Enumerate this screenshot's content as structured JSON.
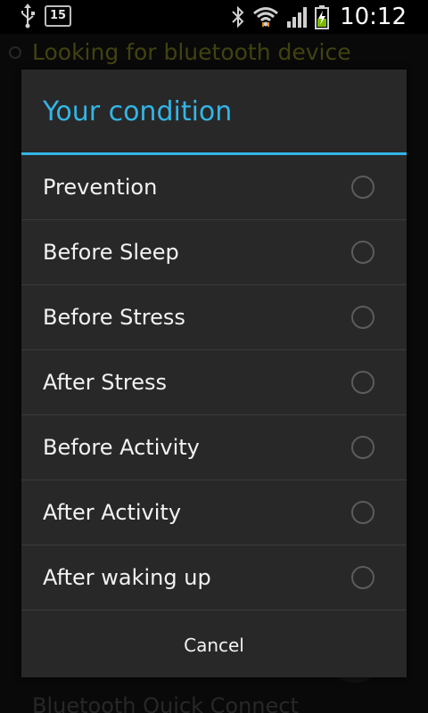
{
  "status_bar": {
    "notification_count": "15",
    "time": "10:12",
    "icons": [
      "usb-icon",
      "bluetooth-icon",
      "wifi-icon",
      "signal-icon",
      "battery-charging-icon"
    ]
  },
  "background": {
    "connection_status": "Looking for bluetooth device",
    "footer_label": "Bluetooth Quick Connect"
  },
  "dialog": {
    "title": "Your condition",
    "options": [
      {
        "label": "Prevention",
        "selected": false
      },
      {
        "label": "Before Sleep",
        "selected": false
      },
      {
        "label": "Before Stress",
        "selected": false
      },
      {
        "label": "After Stress",
        "selected": false
      },
      {
        "label": "Before Activity",
        "selected": false
      },
      {
        "label": "After Activity",
        "selected": false
      },
      {
        "label": "After waking up",
        "selected": false
      }
    ],
    "cancel_label": "Cancel"
  },
  "colors": {
    "accent": "#33b5e5",
    "dialog_background": "#282828",
    "status_text": "#66661a"
  }
}
